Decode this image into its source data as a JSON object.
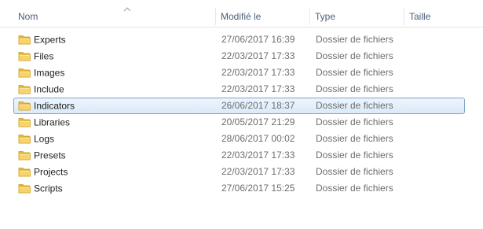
{
  "columns": {
    "name": "Nom",
    "modified": "Modifié le",
    "type": "Type",
    "size": "Taille"
  },
  "rows": [
    {
      "name": "Experts",
      "modified": "27/06/2017 16:39",
      "type": "Dossier de fichiers",
      "size": ""
    },
    {
      "name": "Files",
      "modified": "22/03/2017 17:33",
      "type": "Dossier de fichiers",
      "size": ""
    },
    {
      "name": "Images",
      "modified": "22/03/2017 17:33",
      "type": "Dossier de fichiers",
      "size": ""
    },
    {
      "name": "Include",
      "modified": "22/03/2017 17:33",
      "type": "Dossier de fichiers",
      "size": ""
    },
    {
      "name": "Indicators",
      "modified": "26/06/2017 18:37",
      "type": "Dossier de fichiers",
      "size": "",
      "selected": true
    },
    {
      "name": "Libraries",
      "modified": "20/05/2017 21:29",
      "type": "Dossier de fichiers",
      "size": ""
    },
    {
      "name": "Logs",
      "modified": "28/06/2017 00:02",
      "type": "Dossier de fichiers",
      "size": ""
    },
    {
      "name": "Presets",
      "modified": "22/03/2017 17:33",
      "type": "Dossier de fichiers",
      "size": ""
    },
    {
      "name": "Projects",
      "modified": "22/03/2017 17:33",
      "type": "Dossier de fichiers",
      "size": ""
    },
    {
      "name": "Scripts",
      "modified": "27/06/2017 15:25",
      "type": "Dossier de fichiers",
      "size": ""
    }
  ],
  "colors": {
    "selection_border": "#7da2ce",
    "header_text": "#4c607a",
    "folder_yellow": "#f2c94c"
  },
  "icons": {
    "folder": "folder-icon",
    "sort": "sort-ascending-icon"
  }
}
